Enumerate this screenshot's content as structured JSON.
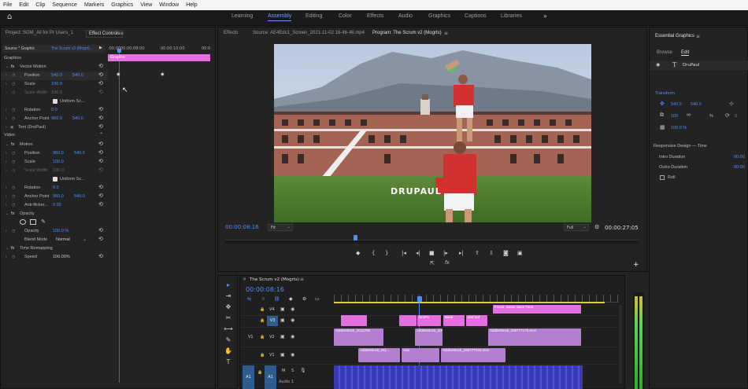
{
  "menu": [
    "File",
    "Edit",
    "Clip",
    "Sequence",
    "Markers",
    "Graphics",
    "View",
    "Window",
    "Help"
  ],
  "workspaces": [
    {
      "label": "Learning",
      "active": false
    },
    {
      "label": "Assembly",
      "active": true
    },
    {
      "label": "Editing",
      "active": false
    },
    {
      "label": "Color",
      "active": false
    },
    {
      "label": "Effects",
      "active": false
    },
    {
      "label": "Audio",
      "active": false
    },
    {
      "label": "Graphics",
      "active": false
    },
    {
      "label": "Captions",
      "active": false
    },
    {
      "label": "Libraries",
      "active": false
    }
  ],
  "left_panel": {
    "tab_project": "Project: SOM_All for Pr Users_1",
    "tab_effect_controls": "Effect Controls",
    "source_label": "Source * Graphic",
    "sequence_label": "The Scrum v2 (Mogrt)...",
    "time_1": ":00:00",
    "time_2": "00:00:09:00",
    "time_3": "00:00:10:00",
    "time_4": "00:0",
    "graphic_header": "Graphics",
    "graphic_clip": "Graphic",
    "vector_motion": "Vector Motion",
    "position": "Position",
    "pos_x": "540.0",
    "pos_y": "540.0",
    "scale": "Scale",
    "scale_val": "100.0",
    "scale_width": "Scale Width",
    "scale_width_val": "100.0",
    "uniform_scale": "Uniform Sc...",
    "rotation": "Rotation",
    "rotation_val": "0.0",
    "anchor": "Anchor Point",
    "anchor_x": "960.0",
    "anchor_y": "540.0",
    "text_layer": "Text (DruPaul)",
    "video_header": "Video",
    "motion": "Motion",
    "position2": "Position",
    "pos2_x": "960.0",
    "pos2_y": "540.0",
    "scale2": "Scale",
    "scale2_val": "100.0",
    "scale_width2": "Scale Width",
    "scale_width2_val": "100.0",
    "uniform_scale2": "Uniform Sc...",
    "rotation2": "Rotation",
    "rotation2_val": "0.0",
    "anchor2": "Anchor Point",
    "anchor2_x": "960.0",
    "anchor2_y": "540.0",
    "anti_flicker": "Anti-flicker...",
    "anti_flicker_val": "0.00",
    "opacity_header": "Opacity",
    "opacity": "Opacity",
    "opacity_val": "100.0 %",
    "blend_mode": "Blend Mode",
    "blend_mode_val": "Normal",
    "time_remap": "Time Remapping",
    "speed": "Speed",
    "speed_val": "100.00%"
  },
  "program": {
    "tab_effects": "Effects",
    "tab_source": "Source: AE4Edc1_Screen_2021-11-02 16-46-46.mp4",
    "tab_program": "Program: The Scrum v2 (Mogrts)",
    "overlay_text": "DRUPAUL",
    "current_time": "00:00:08:16",
    "fit": "Fit",
    "quality": "Full",
    "duration": "00:00:27:05"
  },
  "timeline": {
    "sequence_tab": "The Scrum v2 (Mogrts)",
    "timecode": "00:00:08:16",
    "tracks": [
      {
        "label": "V4"
      },
      {
        "label": "V3"
      },
      {
        "label": "V2"
      },
      {
        "label": "V1"
      },
      {
        "label": "A1"
      }
    ],
    "src_v1": "V1",
    "src_a1": "A1",
    "m_label": "M",
    "s_label": "S",
    "audio_track_name": "Audio 1",
    "clips": [
      {
        "label": "Focus: Name Save Time"
      },
      {
        "label": "DruPa"
      },
      {
        "label": "Bank"
      },
      {
        "label": "and Ind"
      },
      {
        "label": "AdobeStock_2012780"
      },
      {
        "label": "AdobeStock_2/AdobeStock_..."
      },
      {
        "label": "AdobeStock_265777176.mov"
      },
      {
        "label": "AdobeStock_311..."
      },
      {
        "label": "Ado"
      },
      {
        "label": "AdobeStock_265777233.mov"
      }
    ]
  },
  "essential_graphics": {
    "title": "Essential Graphics",
    "tab_browse": "Browse",
    "tab_edit": "Edit",
    "layer": "DruPaul",
    "transform": "Transform",
    "pos_x": "540.0",
    "pos_y": "540.0",
    "scale": "100",
    "rotation": "0",
    "opacity": "100.0 %",
    "responsive": "Responsive Design — Time",
    "intro": "Intro Duration",
    "intro_val": "00:00",
    "outro": "Outro Duration",
    "outro_val": "00:00",
    "roll": "Roll"
  },
  "colors": {
    "accent": "#4d8dff",
    "graphic_clip": "#e56fe0",
    "video_clip": "#b47fd0",
    "audio_clip": "#3a3ab7"
  }
}
